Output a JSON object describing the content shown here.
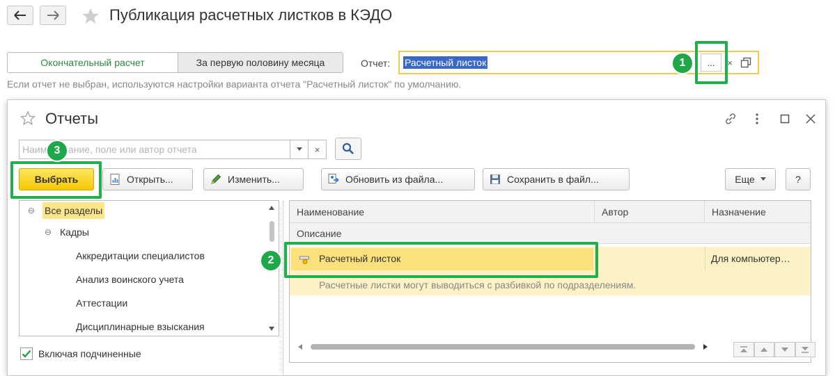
{
  "header": {
    "title": "Публикация расчетных листков в КЭДО",
    "back_icon": "arrow-left-icon",
    "forward_icon": "arrow-right-icon",
    "favorite_icon": "star-icon"
  },
  "tabs": [
    {
      "label": "Окончательный расчет",
      "active": true
    },
    {
      "label": "За первую половину месяца",
      "active": false
    }
  ],
  "report": {
    "label": "Отчет:",
    "value": "Расчетный листок",
    "select_label": "...",
    "clear_label": "×"
  },
  "hint": "Если отчет не выбран, используются настройки варианта отчета \"Расчетный листок\" по умолчанию.",
  "badges": {
    "one": "1",
    "two": "2",
    "three": "3"
  },
  "dialog": {
    "title": "Отчеты",
    "search_placeholder": "Наименование, поле или автор отчета",
    "search_clear": "×",
    "buttons": {
      "choose": "Выбрать",
      "open": "Открыть...",
      "edit": "Изменить...",
      "update_from_file": "Обновить из файла...",
      "save_to_file": "Сохранить в файл...",
      "more": "Еще",
      "help": "?"
    },
    "tree": [
      {
        "label": "Все разделы",
        "level": 0,
        "toggle": "⊖",
        "selected": true
      },
      {
        "label": "Кадры",
        "level": 1,
        "toggle": "⊖",
        "selected": false
      },
      {
        "label": "Аккредитации специалистов",
        "level": 2,
        "toggle": "",
        "selected": false
      },
      {
        "label": "Анализ воинского учета",
        "level": 2,
        "toggle": "",
        "selected": false
      },
      {
        "label": "Аттестации",
        "level": 2,
        "toggle": "",
        "selected": false
      },
      {
        "label": "Дисциплинарные взыскания",
        "level": 2,
        "toggle": "",
        "selected": false
      }
    ],
    "include_subordinate": {
      "label": "Включая подчиненные",
      "checked": true
    },
    "table": {
      "columns": [
        "Наименование",
        "Автор",
        "Назначение"
      ],
      "subheader": "Описание",
      "rows": [
        {
          "name": "Расчетный листок",
          "author": "",
          "purpose": "Для компьютер…",
          "description": "Расчетные листки могут выводиться с разбивкой по подразделениям."
        }
      ]
    }
  },
  "colors": {
    "accent_green": "#20b04b",
    "highlight_yellow": "#fbe07c",
    "selection_blue": "#3a68c6"
  }
}
